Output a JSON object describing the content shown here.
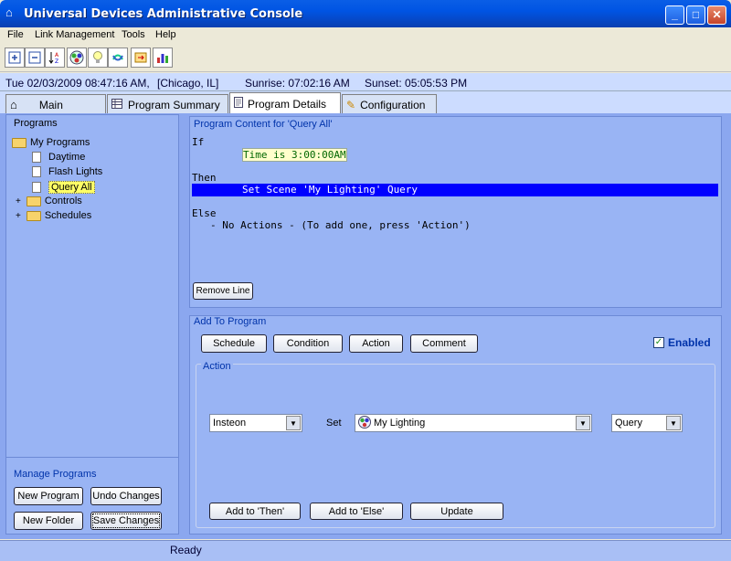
{
  "window": {
    "title": "Universal Devices Administrative Console"
  },
  "menu": [
    "File",
    "Link Management",
    "Tools",
    "Help"
  ],
  "toolbar": {
    "icons": [
      "expand-all-icon",
      "collapse-all-icon",
      "sort-az-icon",
      "scene-icon",
      "bulb-icon",
      "link-icon",
      "export-icon",
      "chart-icon"
    ]
  },
  "status": {
    "datetime": "Tue 02/03/2009 08:47:16 AM,",
    "location": "[Chicago, IL]",
    "sunrise": "Sunrise: 07:02:16 AM",
    "sunset": "Sunset: 05:05:53 PM"
  },
  "tabs": [
    {
      "label": "Main"
    },
    {
      "label": "Program Summary"
    },
    {
      "label": "Program Details"
    },
    {
      "label": "Configuration"
    }
  ],
  "programs": {
    "title": "Programs",
    "root": "My Programs",
    "items": [
      "Daytime",
      "Flash Lights",
      "Query All"
    ],
    "folders": [
      "Controls",
      "Schedules"
    ]
  },
  "manage": {
    "title": "Manage Programs",
    "new_program": "New Program",
    "undo": "Undo Changes",
    "new_folder": "New Folder",
    "save": "Save Changes"
  },
  "content": {
    "title": "Program Content for 'Query All'",
    "if_label": "If",
    "condition": "Time is  3:00:00AM",
    "then_label": "Then",
    "then_action": "Set Scene 'My Lighting' Query",
    "else_label": "Else",
    "else_text": "- No Actions - (To add one, press 'Action')",
    "remove_line": "Remove Line"
  },
  "add": {
    "title": "Add To Program",
    "schedule": "Schedule",
    "condition": "Condition",
    "action": "Action",
    "comment": "Comment",
    "enabled": "Enabled",
    "action_group": "Action",
    "type_value": "Insteon",
    "set_label": "Set",
    "scene_value": "My Lighting",
    "cmd_value": "Query",
    "add_then": "Add to 'Then'",
    "add_else": "Add to 'Else'",
    "update": "Update"
  },
  "statusbar": {
    "text": "Ready"
  },
  "colors": {
    "highlight": "#0000ff",
    "selected_item": "#ffff66",
    "condition_text": "#006600"
  }
}
